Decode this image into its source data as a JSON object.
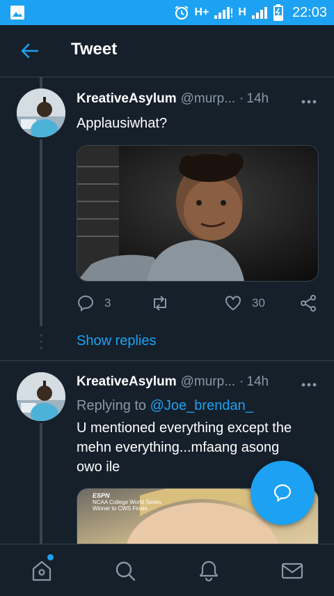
{
  "status_bar": {
    "network1": "H+",
    "network2": "H",
    "battery_icon": "battery-charging-icon",
    "clock": "22:03"
  },
  "header": {
    "back_icon": "arrow-left-icon",
    "title": "Tweet"
  },
  "tweets": [
    {
      "username": "KreativeAsylum",
      "handle": "@murp...",
      "separator": "·",
      "time": "14h",
      "text": "Applausiwhat?",
      "media": "photo of a smiling young girl in a grey top",
      "actions": {
        "replies": "3",
        "retweets": "",
        "likes": "30"
      }
    },
    {
      "username": "KreativeAsylum",
      "handle": "@murp...",
      "separator": "·",
      "time": "14h",
      "replying_prefix": "Replying to",
      "replying_to": "@Joe_brendan_",
      "text_lines": [
        "U mentioned everything except the",
        "mehn everything...mfaang asong",
        "owo ile"
      ],
      "media_caption_lines": [
        "ESPN",
        "NCAA College World Series",
        "Winner to CWS Finals"
      ]
    }
  ],
  "show_replies": "Show replies",
  "colors": {
    "background": "#15202b",
    "accent": "#1da1f2",
    "secondary_text": "#8899a6",
    "divider": "#38444d"
  },
  "bottom_nav": {
    "items": [
      "home-icon",
      "search-icon",
      "notifications-bell-icon",
      "messages-envelope-icon"
    ]
  }
}
